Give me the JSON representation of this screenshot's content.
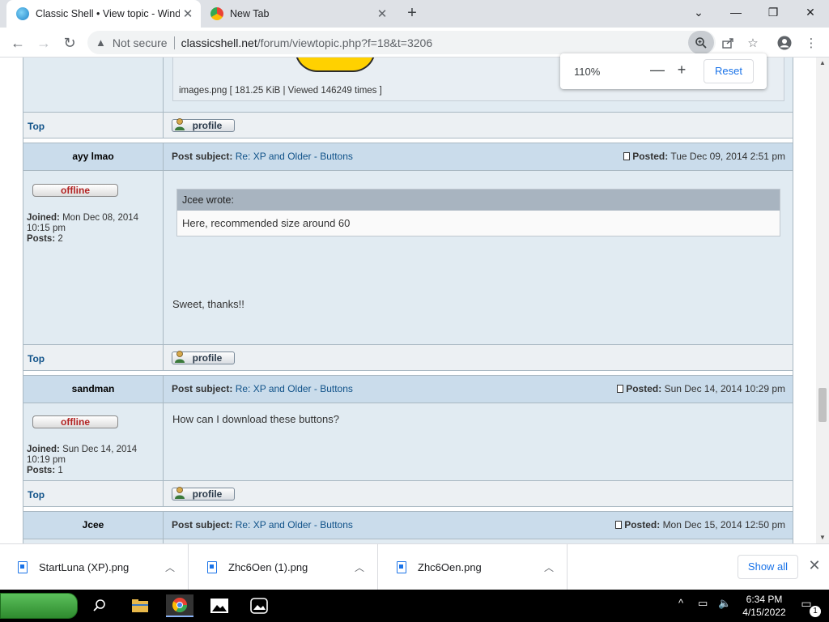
{
  "browser": {
    "tabs": [
      {
        "title": "Classic Shell • View topic - Windo",
        "close": "✕"
      },
      {
        "title": "New Tab",
        "close": "✕"
      }
    ],
    "new_tab": "+",
    "window_controls": {
      "chevron": "⌄",
      "minimize": "—",
      "maximize": "❐",
      "close": "✕"
    },
    "nav": {
      "back": "←",
      "forward": "→",
      "reload": "↻"
    },
    "security_label": "Not secure",
    "url_host": "classicshell.net",
    "url_path": "/forum/viewtopic.php?f=18&t=3206",
    "zoom_popup": {
      "level": "110%",
      "minus": "—",
      "plus": "+",
      "reset": "Reset"
    }
  },
  "forum": {
    "attachment_caption": "images.png [ 181.25 KiB | Viewed 146249 times ]",
    "top_link": "Top",
    "profile_label": "profile",
    "subject_label": "Post subject:",
    "posted_label": "Posted:",
    "posts": [
      {
        "author": "ayy lmao",
        "status": "offline",
        "joined_label": "Joined:",
        "joined": "Mon Dec 08, 2014",
        "joined_time": "10:15 pm",
        "posts_label": "Posts:",
        "posts": "2",
        "subject": "Re: XP and Older - Buttons",
        "posted": "Tue Dec 09, 2014 2:51 pm",
        "quote_author": "Jcee wrote:",
        "quote_text": "Here, recommended size around 60",
        "text": "Sweet, thanks!!"
      },
      {
        "author": "sandman",
        "status": "offline",
        "joined_label": "Joined:",
        "joined": "Sun Dec 14, 2014",
        "joined_time": "10:19 pm",
        "posts_label": "Posts:",
        "posts": "1",
        "subject": "Re: XP and Older - Buttons",
        "posted": "Sun Dec 14, 2014 10:29 pm",
        "text": "How can I download these buttons?"
      },
      {
        "author": "Jcee",
        "subject": "Re: XP and Older - Buttons",
        "posted": "Mon Dec 15, 2014 12:50 pm"
      }
    ]
  },
  "downloads": {
    "items": [
      {
        "name": "StartLuna (XP).png"
      },
      {
        "name": "Zhc6Oen (1).png"
      },
      {
        "name": "Zhc6Oen.png"
      }
    ],
    "show_all": "Show all",
    "close": "✕"
  },
  "taskbar": {
    "clock_time": "6:34 PM",
    "clock_date": "4/15/2022",
    "notification_count": "1"
  },
  "colors": {
    "link": "#105289",
    "header_bg": "#cadceb",
    "post_bg": "#e1ebf2",
    "offline": "#b22222",
    "accent": "#1a73e8"
  }
}
